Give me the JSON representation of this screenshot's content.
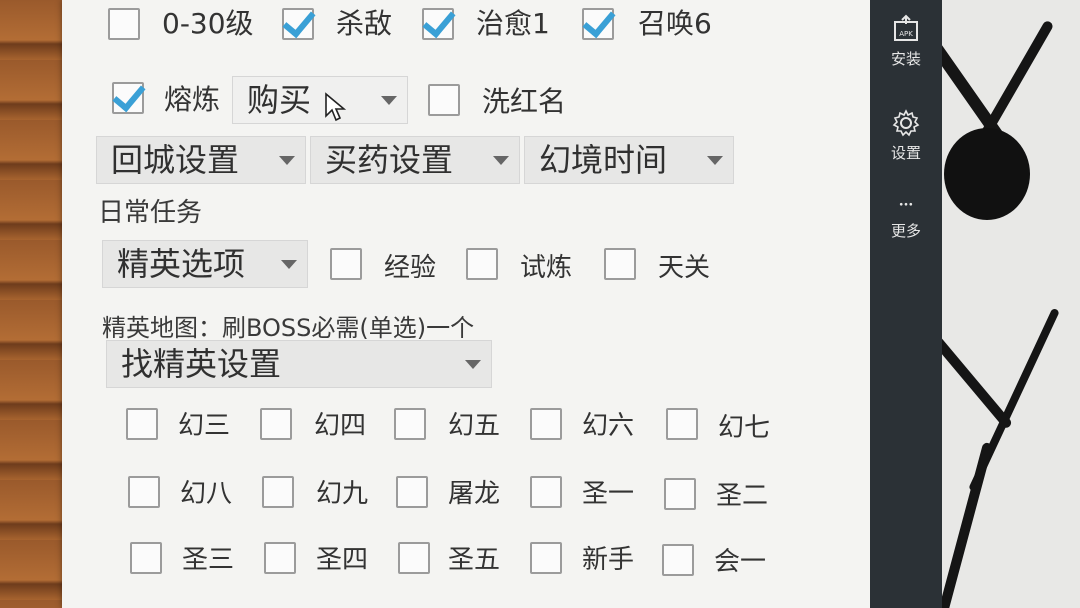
{
  "top_row": [
    {
      "label": "0-30级",
      "checked": false
    },
    {
      "label": "杀敌",
      "checked": true
    },
    {
      "label": "治愈1",
      "checked": true
    },
    {
      "label": "召唤6",
      "checked": true
    }
  ],
  "second_row": {
    "smelt": {
      "label": "熔炼",
      "checked": true
    },
    "smelt_mode": "购买",
    "redname": {
      "label": "洗红名",
      "checked": false
    }
  },
  "settings_spinners": [
    "回城设置",
    "买药设置",
    "幻境时间"
  ],
  "daily": {
    "title": "日常任务",
    "elite_spinner": "精英选项",
    "options": [
      {
        "label": "经验",
        "checked": false
      },
      {
        "label": "试炼",
        "checked": false
      },
      {
        "label": "天关",
        "checked": false
      }
    ]
  },
  "elite_map": {
    "title": "精英地图：刷BOSS必需(单选)一个",
    "find_spinner": "找精英设置",
    "grid": [
      [
        "幻三",
        "幻四",
        "幻五",
        "幻六",
        "幻七"
      ],
      [
        "幻八",
        "幻九",
        "屠龙",
        "圣一",
        "圣二"
      ],
      [
        "圣三",
        "圣四",
        "圣五",
        "新手",
        "会一"
      ]
    ]
  },
  "toolbar": {
    "install_label": "安装",
    "install_icon_text": "APK",
    "settings_label": "设置",
    "more_label": "更多"
  }
}
